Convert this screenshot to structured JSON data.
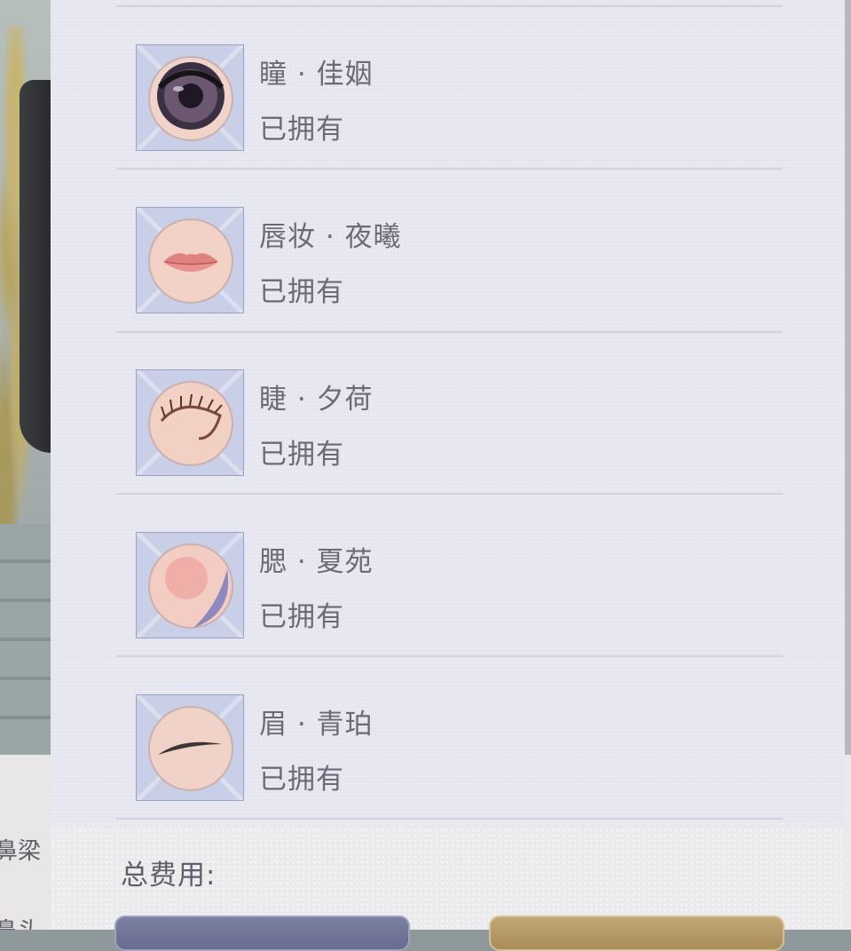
{
  "background": {
    "side_labels": [
      "鼻梁",
      "鼻头"
    ]
  },
  "items": [
    {
      "name": "瞳 · 佳姻",
      "status": "已拥有",
      "icon": "eye-pupil-icon"
    },
    {
      "name": "唇妆 · 夜曦",
      "status": "已拥有",
      "icon": "lips-icon"
    },
    {
      "name": "睫 · 夕荷",
      "status": "已拥有",
      "icon": "eyelash-icon"
    },
    {
      "name": "腮 · 夏苑",
      "status": "已拥有",
      "icon": "blush-icon"
    },
    {
      "name": "眉 · 青珀",
      "status": "已拥有",
      "icon": "eyebrow-icon"
    }
  ],
  "footer": {
    "total_label": "总费用:"
  },
  "colors": {
    "panel_bg": "#e4e5ee",
    "text": "#6a6b76",
    "thumb_bg": "#c9cfe6",
    "cancel_button": "#6f7395",
    "confirm_button": "#b59a66"
  }
}
